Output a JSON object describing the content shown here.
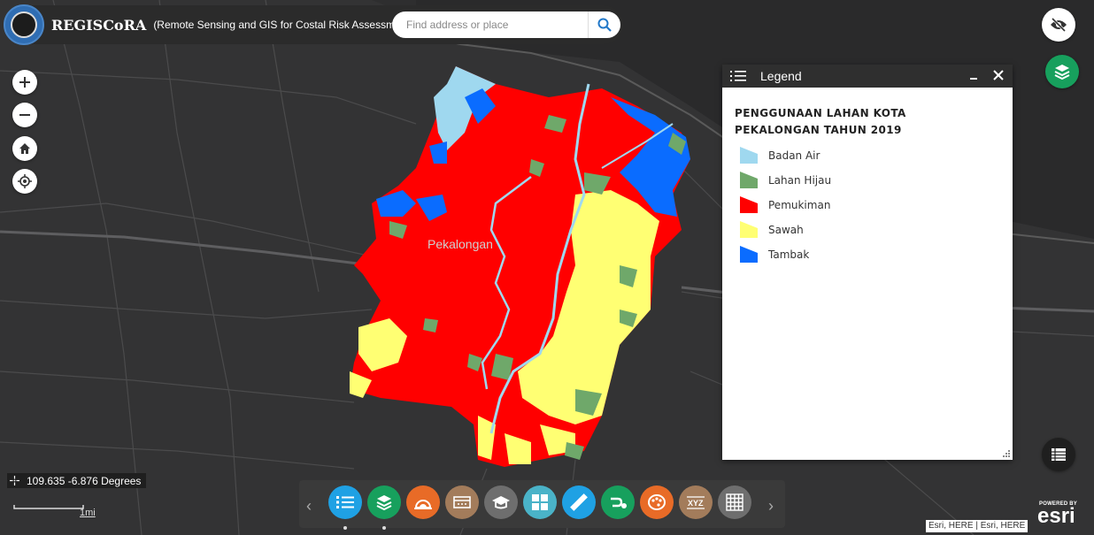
{
  "header": {
    "title": "REGISCoRA",
    "subtitle": "(Remote Sensing and GIS for Costal Risk Assessment)"
  },
  "search": {
    "placeholder": "Find address or place",
    "icon": "search-icon"
  },
  "map": {
    "city_label": "Pekalongan",
    "colors": {
      "background": "#333334",
      "badan_air": "#9fd8ef",
      "lahan_hijau": "#6fa86a",
      "pemukiman": "#ff0000",
      "sawah": "#ffff73",
      "tambak": "#0a6cff"
    }
  },
  "legend": {
    "header": "Legend",
    "layer_title": "PENGGUNAAN LAHAN KOTA PEKALONGAN TAHUN 2019",
    "items": [
      {
        "label": "Badan Air",
        "color": "#9fd8ef"
      },
      {
        "label": "Lahan Hijau",
        "color": "#6fa86a"
      },
      {
        "label": "Pemukiman",
        "color": "#ff0000"
      },
      {
        "label": "Sawah",
        "color": "#ffff73"
      },
      {
        "label": "Tambak",
        "color": "#0a6cff"
      }
    ]
  },
  "coordinates": {
    "text": "109.635 -6.876 Degrees"
  },
  "scalebar": {
    "label": "1mi"
  },
  "toolbar": {
    "tools": [
      {
        "name": "legend-tool",
        "icon": "list-icon",
        "color": "#1fa1e4"
      },
      {
        "name": "layers-tool",
        "icon": "layers-icon",
        "color": "#17a05d"
      },
      {
        "name": "basemap-tool",
        "icon": "sunset-icon",
        "color": "#e86b27"
      },
      {
        "name": "attribute-tool",
        "icon": "table-edit-icon",
        "color": "#a37c5b"
      },
      {
        "name": "about-tool",
        "icon": "graduation-cap-icon",
        "color": "#6e6e6e"
      },
      {
        "name": "basemap-gallery-tool",
        "icon": "grid-icon",
        "color": "#4ab3c8"
      },
      {
        "name": "measure-tool",
        "icon": "ruler-icon",
        "color": "#1fa1e4"
      },
      {
        "name": "directions-tool",
        "icon": "route-icon",
        "color": "#17a05d"
      },
      {
        "name": "swipe-tool",
        "icon": "palette-icon",
        "color": "#e86b27"
      },
      {
        "name": "coordinate-tool",
        "icon": "xyz-icon",
        "color": "#a37c5b"
      },
      {
        "name": "grid-tool",
        "icon": "table-grid-icon",
        "color": "#6e6e6e"
      }
    ]
  },
  "attribution": {
    "text": "Esri, HERE | Esri, HERE"
  },
  "esri": {
    "powered": "POWERED BY",
    "brand": "esri"
  }
}
